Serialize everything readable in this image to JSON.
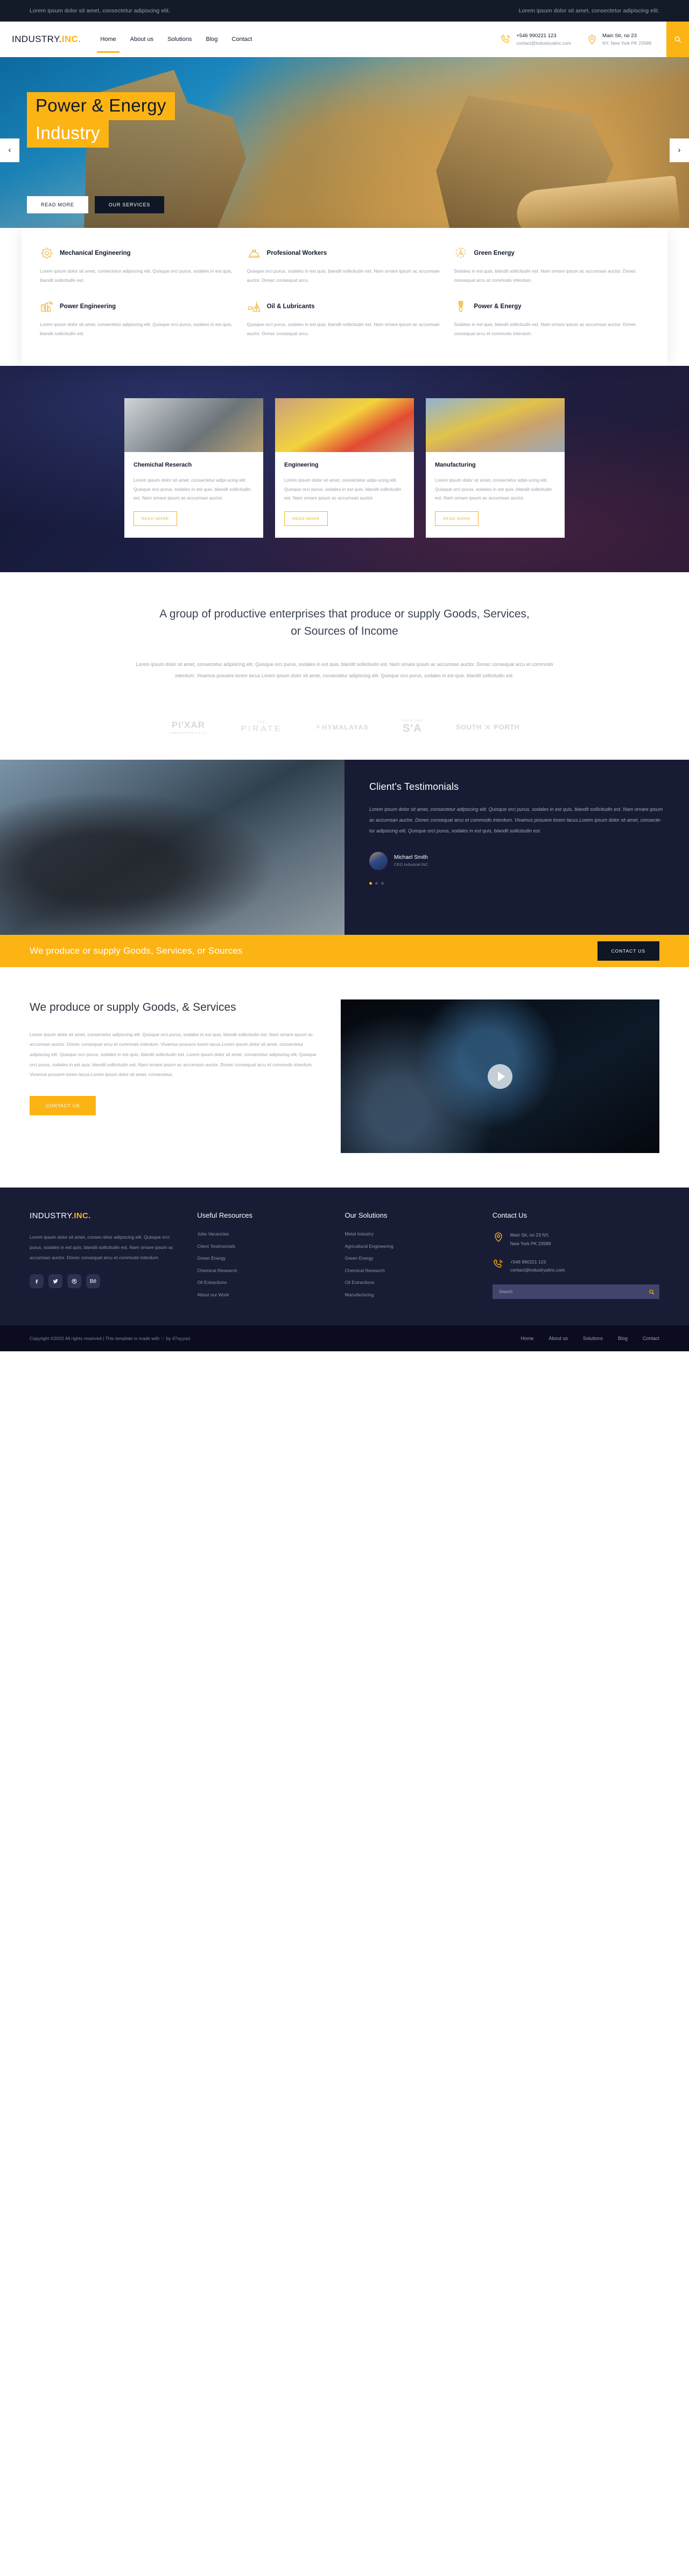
{
  "topbar": {
    "left": "Lorem ipsum dolor sit amet, consectetur adipiscing elit.",
    "right": "Lorem ipsum dolor sit amet, consectetur adipiscing elit."
  },
  "header": {
    "logo_main": "INDUSTRY.",
    "logo_accent": "INC.",
    "nav": [
      {
        "label": "Home",
        "active": true
      },
      {
        "label": "About us",
        "active": false
      },
      {
        "label": "Solutions",
        "active": false
      },
      {
        "label": "Blog",
        "active": false
      },
      {
        "label": "Contact",
        "active": false
      }
    ],
    "phone": "+546 990221 123",
    "email": "contact@industryalinc.com",
    "address_line1": "Main Str, no 23",
    "address_line2": "NY, New York PK 23589"
  },
  "hero": {
    "title_line1": "Power & Energy",
    "title_line2": "Industry",
    "btn_primary": "READ MORE",
    "btn_secondary": "OUR SERVICES",
    "prev": "‹",
    "next": "›"
  },
  "features": [
    {
      "icon": "gear-icon",
      "title": "Mechanical Engineering",
      "text": "Lorem ipsum dolor sit amet, consectetur adipiscing elit. Quisque orci purus, sodales in est quis, blandit sollicitudin est."
    },
    {
      "icon": "helmet-icon",
      "title": "Profesional Workers",
      "text": "Quisque orci purus, sodales in est quis, blandit sollicitudin est. Nam ornare ipsum ac accumsan auctor. Donec consequat arcu."
    },
    {
      "icon": "wind-turbine-icon",
      "title": "Green Energy",
      "text": "Sodales in est quis, blandit sollicitudin est. Nam ornare ipsum ac accumsan auctor. Donec consequat arcu et commodo interdum."
    },
    {
      "icon": "power-plant-icon",
      "title": "Power Engineering",
      "text": "Lorem ipsum dolor sit amet, consectetur adipiscing elit. Quisque orci purus, sodales in est quis, blandit sollicitudin est."
    },
    {
      "icon": "oil-rig-icon",
      "title": "Oil & Lubricants",
      "text": "Quisque orci purus, sodales in est quis, blandit sollicitudin est. Nam ornare ipsum ac accumsan auctor. Donec consequat arcu."
    },
    {
      "icon": "light-bulb-icon",
      "title": "Power & Energy",
      "text": "Sodales in est quis, blandit sollicitudin est. Nam ornare ipsum ac accumsan auctor. Donec consequat arcu et commodo interdum."
    }
  ],
  "cards": [
    {
      "title": "Chemichal Reserach",
      "text": "Lorem ipsum dolor sit amet, consectetur adipi-scing elit. Quisque orci purus, sodales in est quis, blandit sollicitudin est. Nam ornare ipsum ac accumsan auctor.",
      "button": "READ MORE"
    },
    {
      "title": "Engineering",
      "text": "Lorem ipsum dolor sit amet, consectetur adipi-scing elit. Quisque orci purus, sodales in est quis, blandit sollicitudin est. Nam ornare ipsum ac accumsan auctor.",
      "button": "READ MORE"
    },
    {
      "title": "Manufacturing",
      "text": "Lorem ipsum dolor sit amet, consectetur adipi-scing elit. Quisque orci purus, sodales in est quis, blandit sollicitudin est. Nam ornare ipsum ac accumsan auctor.",
      "button": "READ MORE"
    }
  ],
  "intro": {
    "heading": "A group of productive enterprises that produce or supply Goods, Services, or Sources of Income",
    "paragraph": "Lorem ipsum dolor sit amet, consectetur adipiscing elit. Quisque orci purus, sodales in est quis, blandit sollicitudin est. Nam ornare ipsum ac accumsan auctor. Donec consequat arcu et commodo interdum. Vivamus posuere lorem lacus.Lorem ipsum dolor sit amet, consectetur adipiscing elit. Quisque orci purus, sodales in est quis, blandit sollicitudin est."
  },
  "brands": [
    {
      "id": "pixar",
      "main": "PI'XAR",
      "sub": "CONTRACTING S.A.R.L"
    },
    {
      "id": "pirate",
      "top": "THE",
      "main": "PIRATE"
    },
    {
      "id": "hymalayas",
      "star": "✳",
      "main": "HYMALAYAS"
    },
    {
      "id": "sa",
      "top": "SINCE 1990",
      "main": "S'A"
    },
    {
      "id": "southporth",
      "left": "SOUTH",
      "x": "✕",
      "right": "PORTH"
    }
  ],
  "testimonials": {
    "heading": "Client's Testimonials",
    "quote": "Lorem ipsum dolor sit amet, consectetur adipiscing elit. Quisque orci purus, sodales in est quis, blandit sollicitudin est. Nam ornare ipsum ac accumsan auctor. Donec consequat arcu et commodo interdum. Vivamus posuere lorem lacus.Lorem ipsum dolor sit amet, consecte-tur adipiscing elit. Quisque orci purus, sodales in est quis, blandit sollicitudin est.",
    "name": "Michael Smith",
    "role": "CEO Industrial INC"
  },
  "cta": {
    "text": "We produce or supply Goods, Services, or Sources",
    "button": "CONTACT US"
  },
  "produce": {
    "heading": "We produce or supply Goods, & Services",
    "paragraph": "Lorem ipsum dolor sit amet, consectetur adipiscing elit. Quisque orci purus, sodales in est quis, blandit sollicitudin est. Nam ornare ipsum ac accumsan auctor. Donec consequat arcu et commodo interdum. Vivamus posuere lorem lacus.Lorem ipsum dolor sit amet, consectetur adipiscing elit. Quisque orci purus, sodales in est quis, blandit sollicitudin est. Lorem ipsum dolor sit amet, consectetur adipiscing elit. Quisque orci purus, sodales in est quis, blandit sollicitudin est. Nam ornare ipsum ac accumsan auctor. Donec consequat arcu et commodo interdum. Vivamus posuere lorem lacus.Lorem ipsum dolor sit amet, consectetur.",
    "button": "CONTACT US"
  },
  "footer": {
    "logo_main": "INDUSTRY.",
    "logo_accent": "INC.",
    "about": "Lorem ipsum dolor sit amet, consec-tetur adipiscing elit. Quisque orci purus, sodales in est quis, blandit sollicitudin est. Nam ornare ipsum ac accumsan auctor. Donec consequat arcu et commodo interdum.",
    "social": [
      {
        "name": "facebook-icon",
        "glyph": "f"
      },
      {
        "name": "twitter-icon",
        "glyph": "t"
      },
      {
        "name": "dribbble-icon",
        "glyph": "d"
      },
      {
        "name": "behance-icon",
        "glyph": "Bē"
      }
    ],
    "col2_title": "Useful Resources",
    "col2_links": [
      "Jobs Vacancies",
      "Client Testimonials",
      "Green Energy",
      "Chemical Research",
      "Oil Extractions",
      "About our Work"
    ],
    "col3_title": "Our Solutions",
    "col3_links": [
      "Metal Industry",
      "Agricultural Engineering",
      "Green Energy",
      "Chemical Research",
      "Oil Extractions",
      "Manufactoring"
    ],
    "col4_title": "Contact Us",
    "address_line1": "Main Str, no 23 NY,",
    "address_line2": "New York PK 23589",
    "phone": "+546 990221 123",
    "email": "contact@industryalinc.com",
    "search_placeholder": "Search"
  },
  "bottom": {
    "copyright": "Copyright ©2022 All rights reserved | This template is made with ♡ by 47ayyuci",
    "nav": [
      "Home",
      "About us",
      "Solutions",
      "Blog",
      "Contact"
    ]
  },
  "colors": {
    "accent": "#fcb415",
    "dark": "#12192a",
    "footer_bg": "#191c35",
    "bottom_bg": "#0b0c1d"
  }
}
